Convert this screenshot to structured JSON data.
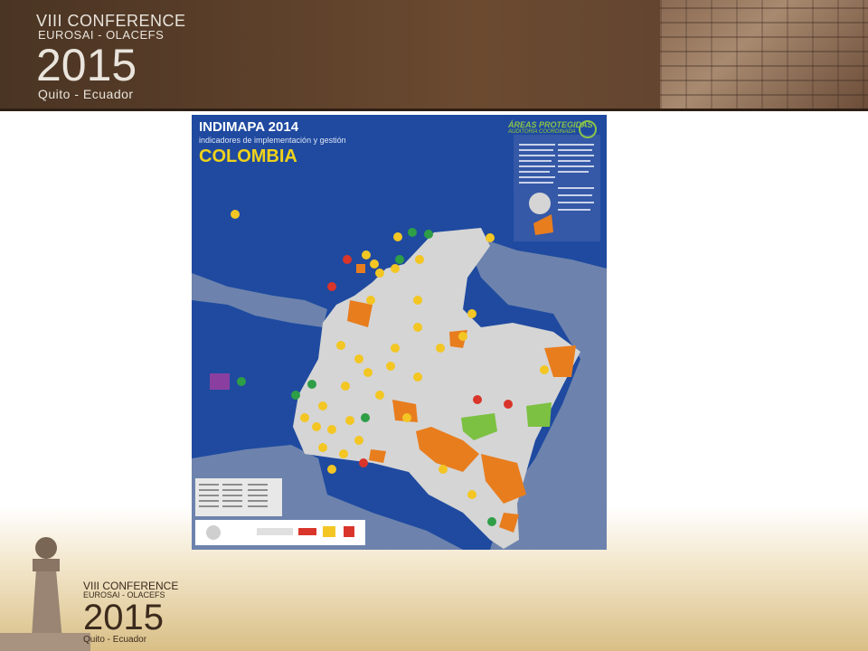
{
  "header": {
    "logo": {
      "line1": "VIII CONFERENCE",
      "line2": "EUROSAI - OLACEFS",
      "year": "2015",
      "line4": "Quito - Ecuador"
    }
  },
  "map": {
    "title": "INDIMAPA 2014",
    "subtitle": "indicadores de implementación y gestión",
    "country": "COLOMBIA",
    "brand": "ÁREAS PROTEGIDAS",
    "brand_sub": "AUDITORÍA COORDINADA",
    "colors": {
      "ocean": "#1f4aa0",
      "land": "#d5d5d5",
      "neighbor": "#6d83ad",
      "orange": "#e87d1e",
      "green": "#7cc142",
      "marker_yellow": "#f3c623",
      "marker_green": "#2e9e47",
      "marker_red": "#d9352a"
    }
  },
  "footer": {
    "logo": {
      "line1": "VIII CONFERENCE",
      "line2": "EUROSAI - OLACEFS",
      "year": "2015",
      "line4": "Quito - Ecuador"
    }
  }
}
